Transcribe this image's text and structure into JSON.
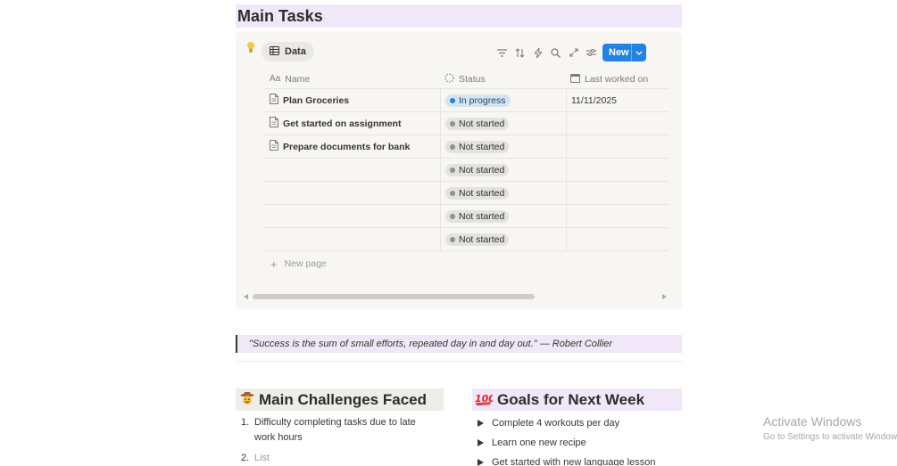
{
  "main_heading": "Main Tasks",
  "database": {
    "view_tab_label": "Data",
    "new_button_label": "New",
    "columns": {
      "name": "Name",
      "status": "Status",
      "last_worked": "Last worked on"
    },
    "rows": [
      {
        "name": "Plan Groceries",
        "status": "In progress",
        "last_worked": "11/11/2025"
      },
      {
        "name": "Get started on assignment",
        "status": "Not started",
        "last_worked": ""
      },
      {
        "name": "Prepare documents for bank",
        "status": "Not started",
        "last_worked": ""
      },
      {
        "name": "",
        "status": "Not started",
        "last_worked": ""
      },
      {
        "name": "",
        "status": "Not started",
        "last_worked": ""
      },
      {
        "name": "",
        "status": "Not started",
        "last_worked": ""
      },
      {
        "name": "",
        "status": "Not started",
        "last_worked": ""
      }
    ],
    "new_page_label": "New page"
  },
  "quote": "\"Success is the sum of small efforts, repeated day in and day out.\" — Robert Collier",
  "challenges": {
    "emoji": "🤠",
    "title": "Main Challenges Faced",
    "items": [
      {
        "num": "1.",
        "text": "Difficulty completing tasks due to late work hours"
      },
      {
        "num": "2.",
        "text": "List"
      }
    ]
  },
  "goals": {
    "emoji": "💯",
    "title": "Goals for Next Week",
    "items": [
      "Complete 4 workouts per day",
      "Learn one new recipe",
      "Get started with new language lesson"
    ]
  },
  "watermark": {
    "line1": "Activate Windows",
    "line2": "Go to Settings to activate Windows."
  },
  "colors": {
    "accent_blue": "#2383e2",
    "purple_highlight": "#f0e7f8",
    "gray_highlight": "#eeedea"
  }
}
